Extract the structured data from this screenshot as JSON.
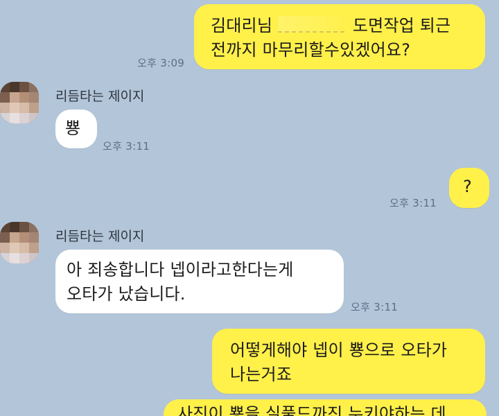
{
  "chat": {
    "messages": [
      {
        "sender_side": "mine",
        "line1_name": "김대리님",
        "line1_rest": "도면작업 퇴근",
        "line2": "전까지 마무리할수있겠어요?",
        "time": "오후 3:09"
      },
      {
        "sender_side": "theirs",
        "sender_name": "리듬타는 제이지",
        "text": "뿅",
        "time": "오후 3:11"
      },
      {
        "sender_side": "mine",
        "text": "?",
        "time": "오후 3:11"
      },
      {
        "sender_side": "theirs",
        "sender_name": "리듬타는 제이지",
        "line1": "아 죄송합니다 넵이라고한다는게",
        "line2": "오타가 났습니다.",
        "time": "오후 3:11"
      },
      {
        "sender_side": "mine",
        "line1": "어떻게해야 넵이 뿅으로 오타가",
        "line2": "나는거죠"
      },
      {
        "sender_side": "mine",
        "partial_line": "사진이 뿅을 실풀드까진 누키야하는 데"
      }
    ]
  },
  "colors": {
    "background": "#b3c5d8",
    "my_bubble": "#fff04a",
    "their_bubble": "#ffffff",
    "timestamp": "#59708a"
  }
}
